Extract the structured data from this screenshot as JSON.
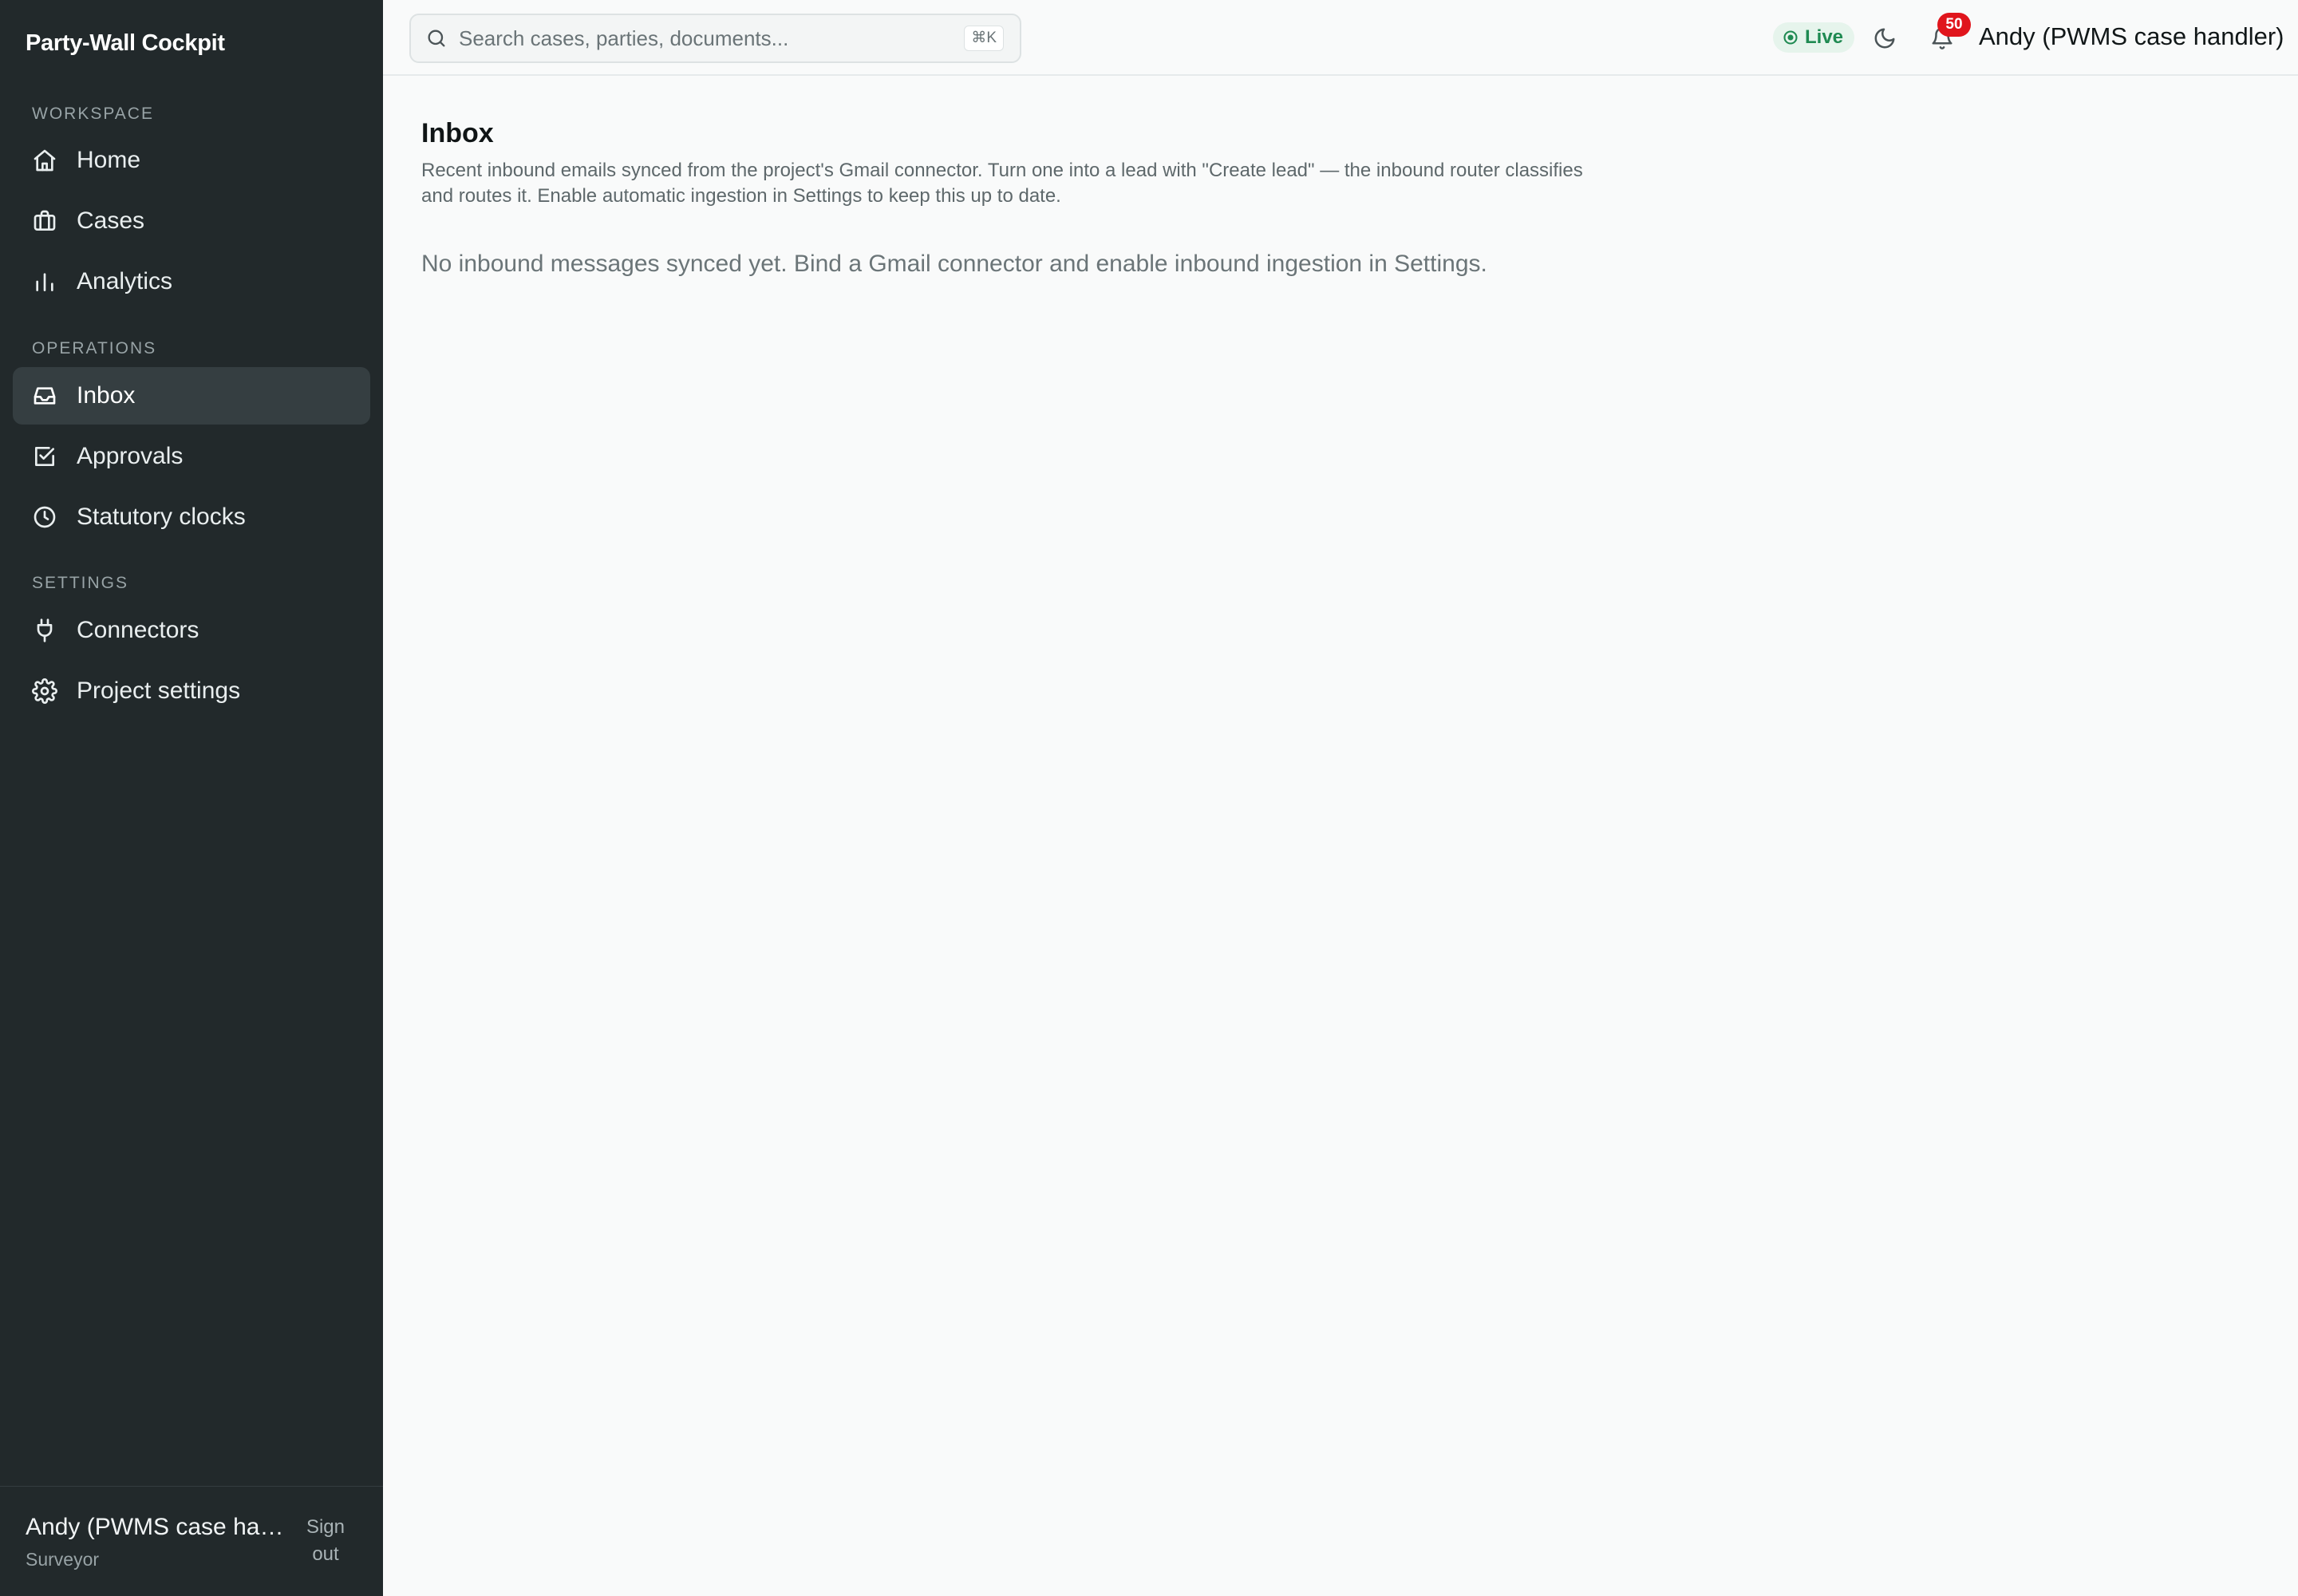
{
  "app": {
    "title": "Party-Wall Cockpit"
  },
  "sidebar": {
    "sections": {
      "workspace": "Workspace",
      "operations": "Operations",
      "settings": "Settings"
    },
    "items": [
      {
        "label": "Home",
        "icon": "home-icon"
      },
      {
        "label": "Cases",
        "icon": "briefcase-icon"
      },
      {
        "label": "Analytics",
        "icon": "bar-chart-icon"
      },
      {
        "label": "Inbox",
        "icon": "inbox-icon",
        "active": true
      },
      {
        "label": "Approvals",
        "icon": "check-square-icon"
      },
      {
        "label": "Statutory clocks",
        "icon": "clock-icon"
      },
      {
        "label": "Connectors",
        "icon": "plug-icon"
      },
      {
        "label": "Project settings",
        "icon": "gear-icon"
      }
    ],
    "footer": {
      "name": "Andy (PWMS case handler)",
      "role": "Surveyor",
      "signout": "Sign out"
    }
  },
  "topbar": {
    "search": {
      "placeholder": "Search cases, parties, documents...",
      "shortcut": "⌘K"
    },
    "status": "Live",
    "notifications": "50",
    "user": "Andy (PWMS case handler)"
  },
  "main": {
    "title": "Inbox",
    "description": "Recent inbound emails synced from the project's Gmail connector. Turn one into a lead with \"Create lead\" — the inbound router classifies and routes it. Enable automatic ingestion in Settings to keep this up to date.",
    "empty_message": "No inbound messages synced yet. Bind a Gmail connector and enable inbound ingestion in Settings."
  },
  "colors": {
    "sidebar_bg": "#22292b",
    "active_item_bg": "#353e41",
    "live_green": "#1f8a52",
    "badge_red": "#e0151c"
  }
}
